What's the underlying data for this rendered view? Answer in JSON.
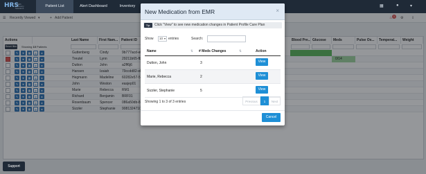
{
  "app": {
    "logo": "HRS",
    "logo_sub": "Health Recovery Solutions"
  },
  "nav": {
    "tabs": [
      "Patient List",
      "Alert Dashboard",
      "Inventory"
    ]
  },
  "toolbar": {
    "recently_viewed": "Recently Viewed",
    "add_patient": "Add Patient",
    "alert_count": "1"
  },
  "grid": {
    "headers": [
      "Actions",
      "Last Name",
      "First Nam...",
      "Patient ID",
      "Blood Pre...",
      "Glucose",
      "Meds",
      "Pulse Ox...",
      "Temperat...",
      "Weight"
    ],
    "showing_label": "Showing",
    "showing_count": "10",
    "showing_suffix": "Patients",
    "reset_label": "Reset filter",
    "meds_value": "0/14",
    "rows": [
      {
        "last": "Guttenberg",
        "first": "Cindy",
        "pid": "9b777acd-eb",
        "checked": false
      },
      {
        "last": "Treutel",
        "first": "Lynn",
        "pid": "29211b65-fb",
        "checked": true
      },
      {
        "last": "Dutton",
        "first": "John",
        "pid": "a2ff6j6",
        "checked": false
      },
      {
        "last": "Hansen",
        "first": "Izaiah",
        "pid": "79ccdd82-eb",
        "checked": false
      },
      {
        "last": "Hegmann",
        "first": "Madeline",
        "pid": "60282e57-57",
        "checked": false
      },
      {
        "last": "John",
        "first": "Weston",
        "pid": "easjep01",
        "checked": false
      },
      {
        "last": "Marie",
        "first": "Rebecca",
        "pid": "RM1",
        "checked": false
      },
      {
        "last": "Richard",
        "first": "Benjamin",
        "pid": "BRF01",
        "checked": false
      },
      {
        "last": "Rosenbaum",
        "first": "Spencer",
        "pid": "086a50db-82",
        "checked": false
      },
      {
        "last": "Sizzler",
        "first": "Stephanie",
        "pid": "9081324710",
        "checked": false
      }
    ]
  },
  "support_label": "Support",
  "modal": {
    "title": "New Medication from EMR",
    "close_glyph": "×",
    "tip_badge": "Tip:",
    "tip_text": "Click \"View\" to see new medication changes in Patient Profile Care Plan",
    "show_label": "Show",
    "entries_value": "10",
    "entries_label": "entries",
    "search_label": "Search:",
    "search_value": "",
    "columns": {
      "name": "Name",
      "changes": "# Meds Changes",
      "action": "Action"
    },
    "rows": [
      {
        "name": "Dutton, John",
        "changes": "3",
        "action": "View"
      },
      {
        "name": "Marie, Rebecca",
        "changes": "2",
        "action": "View"
      },
      {
        "name": "Sizzler, Stephanie",
        "changes": "5",
        "action": "View"
      }
    ],
    "info": "Showing 1 to 3 of 3 entries",
    "pager": {
      "previous": "Previous",
      "page": "1",
      "next": "Next"
    },
    "cancel": "Cancel"
  }
}
